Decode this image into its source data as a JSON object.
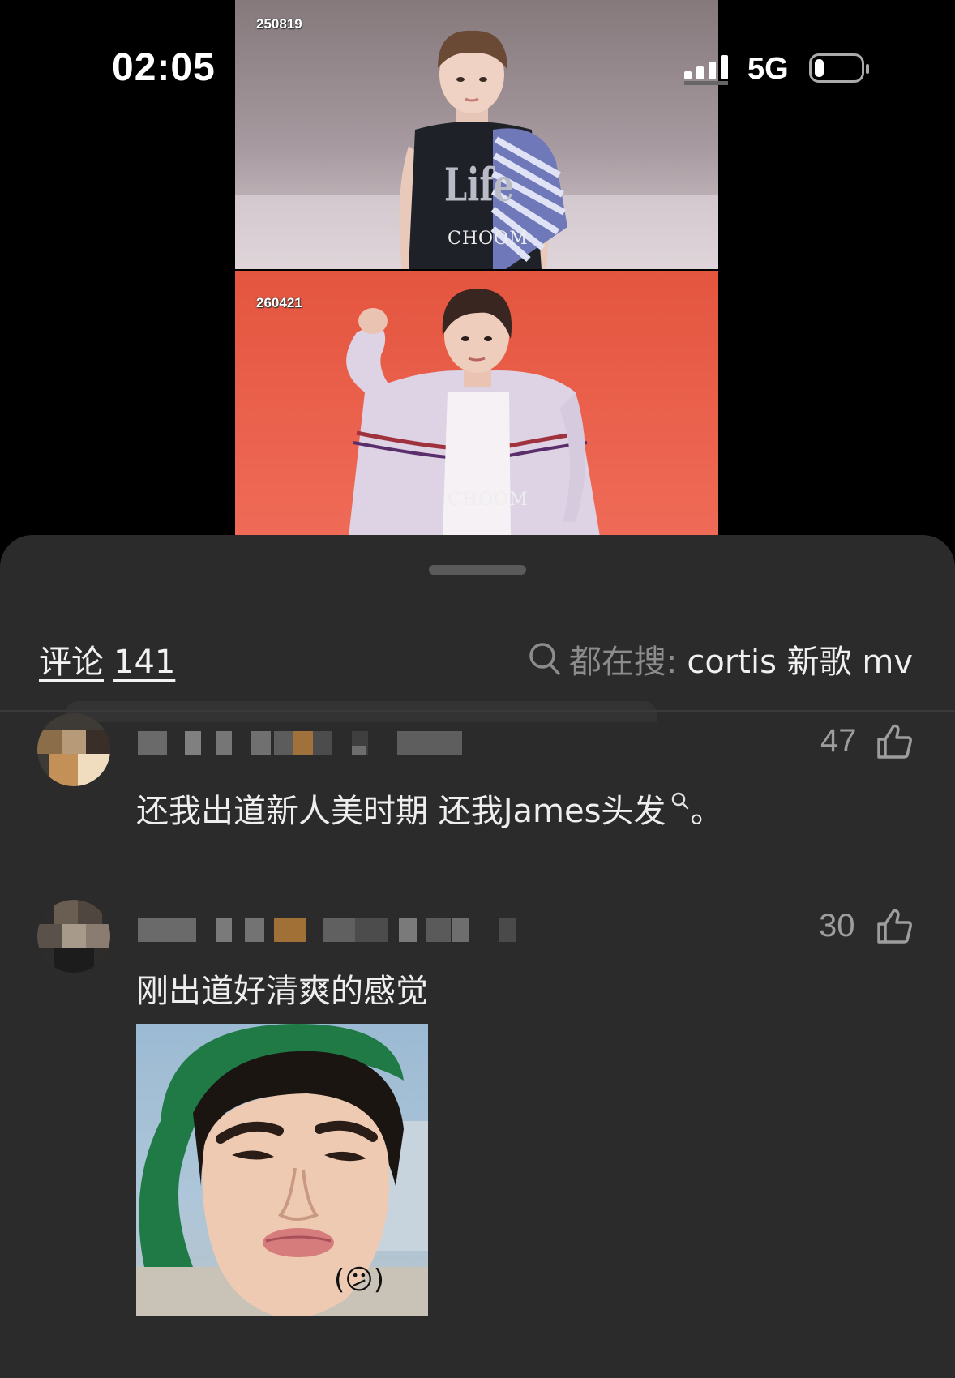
{
  "status_bar": {
    "time": "02:05",
    "network": "5G",
    "battery_level": 0.2
  },
  "video": {
    "panels": [
      {
        "date": "250819",
        "logo_text": "CHOOM",
        "shirt_text": "Life",
        "bg_color": "#a79aa0"
      },
      {
        "date": "260421",
        "logo_text": "CHOOM",
        "bg_color": "#e8583f"
      }
    ]
  },
  "comments_sheet": {
    "title_label": "评论",
    "comment_count": "141",
    "search_hint_label": "都在搜:",
    "search_hint_query": "cortis 新歌 mv"
  },
  "comments": [
    {
      "username": "",
      "like_count": "47",
      "text": "还我出道新人美时期 还我James头发",
      "suffix": "。",
      "has_search_link": true
    },
    {
      "username": "",
      "like_count": "30",
      "text": "刚出道好清爽的感觉",
      "has_sticker": true,
      "sticker_emoji": "(😕)"
    }
  ],
  "colors": {
    "sheet_bg": "#2b2b2b",
    "text_primary": "#eeeeee",
    "text_secondary": "#9d9d9d",
    "hint_label": "#8c8c8c"
  },
  "icons": [
    "search-icon",
    "thumbs-up-icon",
    "signal-icon",
    "battery-icon"
  ]
}
